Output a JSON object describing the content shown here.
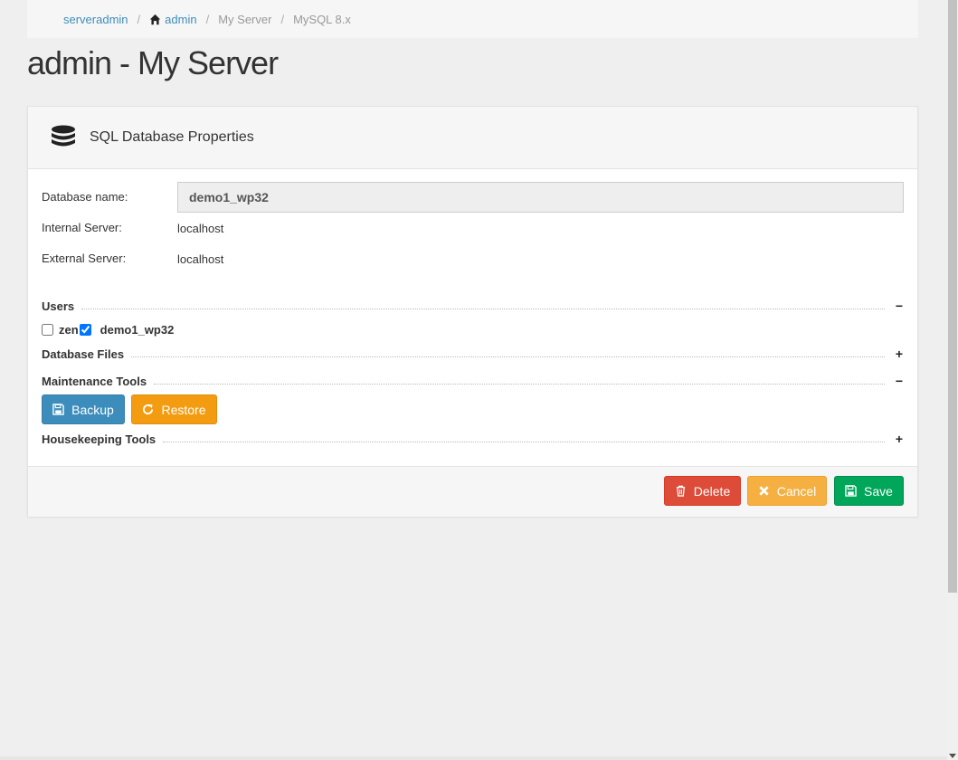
{
  "breadcrumb": {
    "items": [
      {
        "label": "serveradmin",
        "link": true
      },
      {
        "label": "admin",
        "link": true,
        "icon": "home-icon"
      },
      {
        "label": "My Server",
        "link": false
      },
      {
        "label": "MySQL 8.x",
        "link": false
      }
    ],
    "separator": "/"
  },
  "page": {
    "title": "admin - My Server"
  },
  "card": {
    "title": "SQL Database Properties",
    "icon": "database-icon",
    "fields": {
      "db_name_label": "Database name:",
      "db_name_value": "demo1_wp32",
      "internal_label": "Internal Server:",
      "internal_value": "localhost",
      "external_label": "External Server:",
      "external_value": "localhost"
    },
    "sections": {
      "users": {
        "label": "Users",
        "toggle": "−"
      },
      "files": {
        "label": "Database Files",
        "toggle": "+"
      },
      "maintenance": {
        "label": "Maintenance Tools",
        "toggle": "−"
      },
      "housekeeping": {
        "label": "Housekeeping Tools",
        "toggle": "+"
      }
    },
    "users": [
      {
        "label": "zen",
        "checked": false
      },
      {
        "label": "demo1_wp32",
        "checked": true
      }
    ],
    "maintenance_buttons": {
      "backup": "Backup",
      "restore": "Restore"
    },
    "footer_buttons": {
      "delete": "Delete",
      "cancel": "Cancel",
      "save": "Save"
    }
  },
  "colors": {
    "primary": "#3c8dbc",
    "warning": "#f39c12",
    "danger": "#dd4b39",
    "success": "#00a65a"
  }
}
